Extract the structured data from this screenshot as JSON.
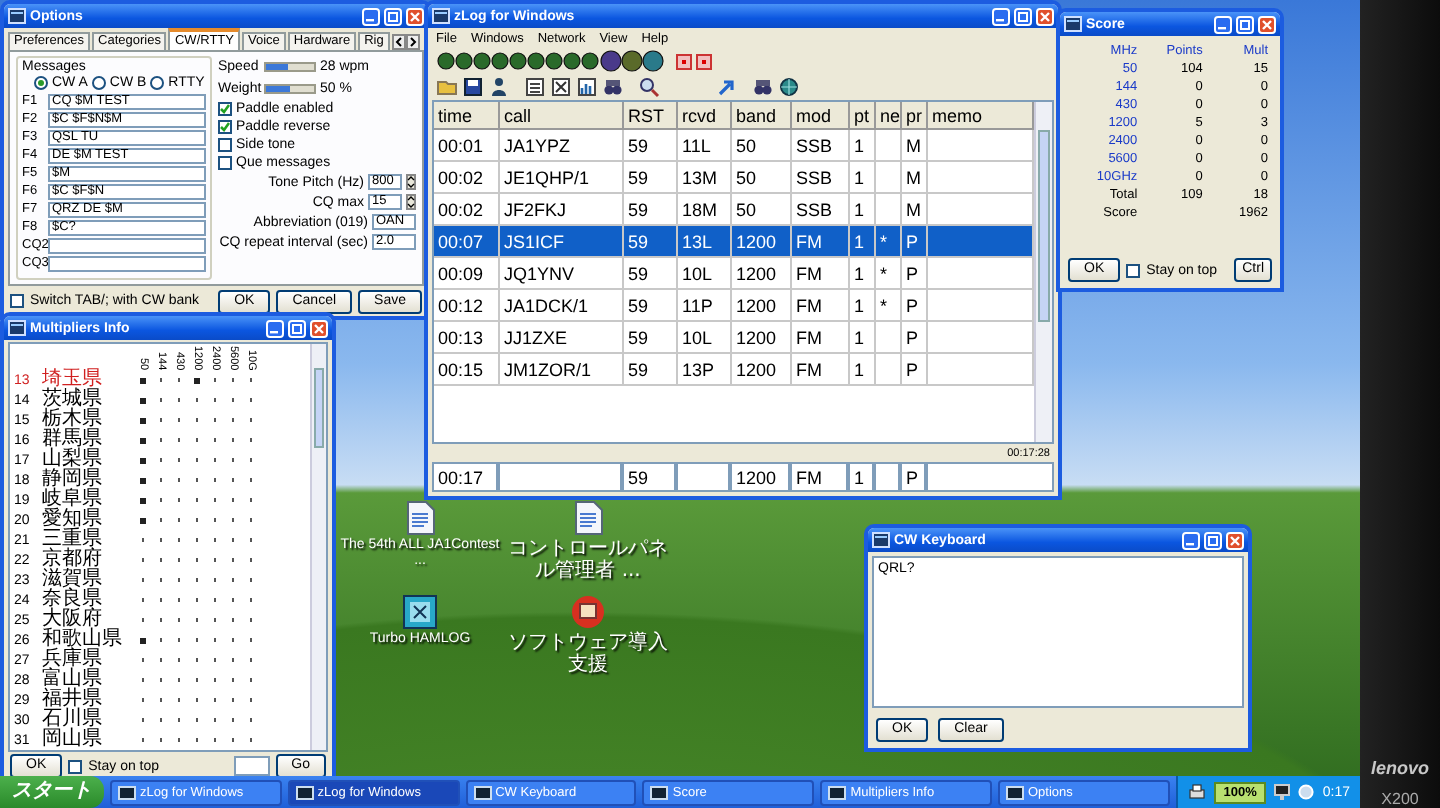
{
  "options_window": {
    "title": "Options",
    "tabs": [
      {
        "label": "Preferences",
        "selected": false
      },
      {
        "label": "Categories",
        "selected": false
      },
      {
        "label": "CW/RTTY",
        "selected": true
      },
      {
        "label": "Voice",
        "selected": false
      },
      {
        "label": "Hardware",
        "selected": false
      },
      {
        "label": "Rig",
        "selected": false
      }
    ],
    "messages": {
      "label": "Messages",
      "banks": [
        {
          "label": "CW A",
          "selected": true
        },
        {
          "label": "CW B",
          "selected": false
        },
        {
          "label": "RTTY",
          "selected": false
        }
      ],
      "keys": [
        {
          "key": "F1",
          "value": "CQ $M TEST"
        },
        {
          "key": "F2",
          "value": "$C $F$N$M"
        },
        {
          "key": "F3",
          "value": "QSL TU"
        },
        {
          "key": "F4",
          "value": "DE $M TEST"
        },
        {
          "key": "F5",
          "value": "$M"
        },
        {
          "key": "F6",
          "value": "$C $F$N"
        },
        {
          "key": "F7",
          "value": "QRZ DE $M"
        },
        {
          "key": "F8",
          "value": "$C?"
        }
      ],
      "cq_fields": [
        {
          "label": "CQ2"
        },
        {
          "label": "CQ3"
        }
      ]
    },
    "speed": {
      "label": "Speed",
      "level": 0.45,
      "reading": "28 wpm"
    },
    "weight": {
      "label": "Weight",
      "level": 0.5,
      "reading": "50 %"
    },
    "checkboxes": [
      {
        "label": "Paddle enabled",
        "checked": true
      },
      {
        "label": "Paddle reverse",
        "checked": true
      },
      {
        "label": "Side tone",
        "checked": false
      },
      {
        "label": "Que messages",
        "checked": false
      }
    ],
    "settings": [
      {
        "label": "Tone Pitch (Hz)",
        "value": "800",
        "kind": "spin"
      },
      {
        "label": "CQ max",
        "value": "15",
        "kind": "spin"
      },
      {
        "label": "Abbreviation (019)",
        "value": "OAN",
        "kind": "text"
      },
      {
        "label": "CQ repeat interval (sec)",
        "value": "2.0",
        "kind": "text"
      }
    ],
    "switch_option": {
      "label": "Switch TAB/; with CW bank",
      "checked": false
    },
    "buttons": [
      "OK",
      "Cancel",
      "Save"
    ]
  },
  "zlog_window": {
    "title": "zLog for Windows",
    "menu": [
      "File",
      "Windows",
      "Network",
      "View",
      "Help"
    ],
    "columns": [
      "time",
      "call",
      "RST",
      "rcvd",
      "band",
      "mod",
      "pt",
      "ne",
      "pr",
      "memo"
    ],
    "rows": [
      {
        "time": "00:01",
        "call": "JA1YPZ",
        "rst": "59",
        "rcvd": "11L",
        "band": "50",
        "mod": "SSB",
        "pt": "1",
        "pr": "M",
        "selected": false
      },
      {
        "time": "00:02",
        "call": "JE1QHP/1",
        "rst": "59",
        "rcvd": "13M",
        "band": "50",
        "mod": "SSB",
        "pt": "1",
        "pr": "M",
        "selected": false
      },
      {
        "time": "00:02",
        "call": "JF2FKJ",
        "rst": "59",
        "rcvd": "18M",
        "band": "50",
        "mod": "SSB",
        "pt": "1",
        "pr": "M",
        "selected": false
      },
      {
        "time": "00:07",
        "call": "JS1ICF",
        "rst": "59",
        "rcvd": "13L",
        "band": "1200",
        "mod": "FM",
        "pt": "1",
        "ne": "*",
        "pr": "P",
        "selected": true
      },
      {
        "time": "00:09",
        "call": "JQ1YNV",
        "rst": "59",
        "rcvd": "10L",
        "band": "1200",
        "mod": "FM",
        "pt": "1",
        "ne": "*",
        "pr": "P",
        "selected": false
      },
      {
        "time": "00:12",
        "call": "JA1DCK/1",
        "rst": "59",
        "rcvd": "11P",
        "band": "1200",
        "mod": "FM",
        "pt": "1",
        "ne": "*",
        "pr": "P",
        "selected": false
      },
      {
        "time": "00:13",
        "call": "JJ1ZXE",
        "rst": "59",
        "rcvd": "10L",
        "band": "1200",
        "mod": "FM",
        "pt": "1",
        "pr": "P",
        "selected": false
      },
      {
        "time": "00:15",
        "call": "JM1ZOR/1",
        "rst": "59",
        "rcvd": "13P",
        "band": "1200",
        "mod": "FM",
        "pt": "1",
        "pr": "P",
        "selected": false
      }
    ],
    "status": "00:17:28",
    "entry": {
      "time": "00:17",
      "rst": "59",
      "band": "1200",
      "mod": "FM",
      "pt": "1",
      "pr": "P"
    }
  },
  "score_window": {
    "title": "Score",
    "columns": [
      "MHz",
      "Points",
      "Mult"
    ],
    "rows": [
      {
        "label": "50",
        "points": "104",
        "mult": "15",
        "kind": "band"
      },
      {
        "label": "144",
        "points": "0",
        "mult": "0",
        "kind": "band"
      },
      {
        "label": "430",
        "points": "0",
        "mult": "0",
        "kind": "band"
      },
      {
        "label": "1200",
        "points": "5",
        "mult": "3",
        "kind": "band"
      },
      {
        "label": "2400",
        "points": "0",
        "mult": "0",
        "kind": "band"
      },
      {
        "label": "5600",
        "points": "0",
        "mult": "0",
        "kind": "band"
      },
      {
        "label": "10GHz",
        "points": "0",
        "mult": "0",
        "kind": "band"
      },
      {
        "label": "Total",
        "points": "109",
        "mult": "18",
        "kind": "total"
      },
      {
        "label": "Score",
        "mult": "1962",
        "kind": "total"
      }
    ],
    "stay_on_top": {
      "label": "Stay on top",
      "checked": false
    },
    "buttons": [
      "OK",
      "Ctrl"
    ]
  },
  "multipliers_window": {
    "title": "Multipliers Info",
    "bands": [
      "50",
      "144",
      "430",
      "1200",
      "2400",
      "5600",
      "10G"
    ],
    "rows": [
      {
        "number": "13",
        "name": "埼玉県",
        "highlighted": true,
        "worked": [
          true,
          false,
          false,
          true,
          false,
          false,
          false
        ]
      },
      {
        "number": "14",
        "name": "茨城県",
        "highlighted": false,
        "worked": [
          true,
          false,
          false,
          false,
          false,
          false,
          false
        ]
      },
      {
        "number": "15",
        "name": "栃木県",
        "highlighted": false,
        "worked": [
          true,
          false,
          false,
          false,
          false,
          false,
          false
        ]
      },
      {
        "number": "16",
        "name": "群馬県",
        "highlighted": false,
        "worked": [
          true,
          false,
          false,
          false,
          false,
          false,
          false
        ]
      },
      {
        "number": "17",
        "name": "山梨県",
        "highlighted": false,
        "worked": [
          true,
          false,
          false,
          false,
          false,
          false,
          false
        ]
      },
      {
        "number": "18",
        "name": "静岡県",
        "highlighted": false,
        "worked": [
          true,
          false,
          false,
          false,
          false,
          false,
          false
        ]
      },
      {
        "number": "19",
        "name": "岐阜県",
        "highlighted": false,
        "worked": [
          true,
          false,
          false,
          false,
          false,
          false,
          false
        ]
      },
      {
        "number": "20",
        "name": "愛知県",
        "highlighted": false,
        "worked": [
          true,
          false,
          false,
          false,
          false,
          false,
          false
        ]
      },
      {
        "number": "21",
        "name": "三重県",
        "highlighted": false,
        "worked": [
          false,
          false,
          false,
          false,
          false,
          false,
          false
        ]
      },
      {
        "number": "22",
        "name": "京都府",
        "highlighted": false,
        "worked": [
          false,
          false,
          false,
          false,
          false,
          false,
          false
        ]
      },
      {
        "number": "23",
        "name": "滋賀県",
        "highlighted": false,
        "worked": [
          false,
          false,
          false,
          false,
          false,
          false,
          false
        ]
      },
      {
        "number": "24",
        "name": "奈良県",
        "highlighted": false,
        "worked": [
          false,
          false,
          false,
          false,
          false,
          false,
          false
        ]
      },
      {
        "number": "25",
        "name": "大阪府",
        "highlighted": false,
        "worked": [
          false,
          false,
          false,
          false,
          false,
          false,
          false
        ]
      },
      {
        "number": "26",
        "name": "和歌山県",
        "highlighted": false,
        "worked": [
          true,
          false,
          false,
          false,
          false,
          false,
          false
        ]
      },
      {
        "number": "27",
        "name": "兵庫県",
        "highlighted": false,
        "worked": [
          false,
          false,
          false,
          false,
          false,
          false,
          false
        ]
      },
      {
        "number": "28",
        "name": "富山県",
        "highlighted": false,
        "worked": [
          false,
          false,
          false,
          false,
          false,
          false,
          false
        ]
      },
      {
        "number": "29",
        "name": "福井県",
        "highlighted": false,
        "worked": [
          false,
          false,
          false,
          false,
          false,
          false,
          false
        ]
      },
      {
        "number": "30",
        "name": "石川県",
        "highlighted": false,
        "worked": [
          false,
          false,
          false,
          false,
          false,
          false,
          false
        ]
      },
      {
        "number": "31",
        "name": "岡山県",
        "highlighted": false,
        "worked": [
          false,
          false,
          false,
          false,
          false,
          false,
          false
        ]
      }
    ],
    "stay_on_top": {
      "label": "Stay on top",
      "checked": false
    },
    "buttons": [
      "OK",
      "Go"
    ]
  },
  "cw_keyboard_window": {
    "title": "CW Keyboard",
    "text": "QRL?",
    "buttons": [
      "OK",
      "Clear"
    ]
  },
  "desktop_icons": [
    {
      "label": "The 54th ALL JA1Contest ...",
      "kind": "document"
    },
    {
      "label": "コントロールパネル管理者 ...",
      "kind": "document"
    },
    {
      "label": "Turbo HAMLOG",
      "kind": "logbook"
    },
    {
      "label": "ソフトウェア導入支援",
      "kind": "installer"
    }
  ],
  "taskbar": {
    "start": "スタート",
    "items": [
      {
        "label": "zLog for Windows",
        "selected": false
      },
      {
        "label": "zLog for Windows",
        "selected": true
      },
      {
        "label": "CW Keyboard",
        "selected": false
      },
      {
        "label": "Score",
        "selected": false
      },
      {
        "label": "Multipliers Info",
        "selected": false
      },
      {
        "label": "Options",
        "selected": false
      }
    ],
    "battery": "100%",
    "clock": "0:17"
  },
  "laptop": {
    "brand": "lenovo",
    "model": "X200"
  }
}
